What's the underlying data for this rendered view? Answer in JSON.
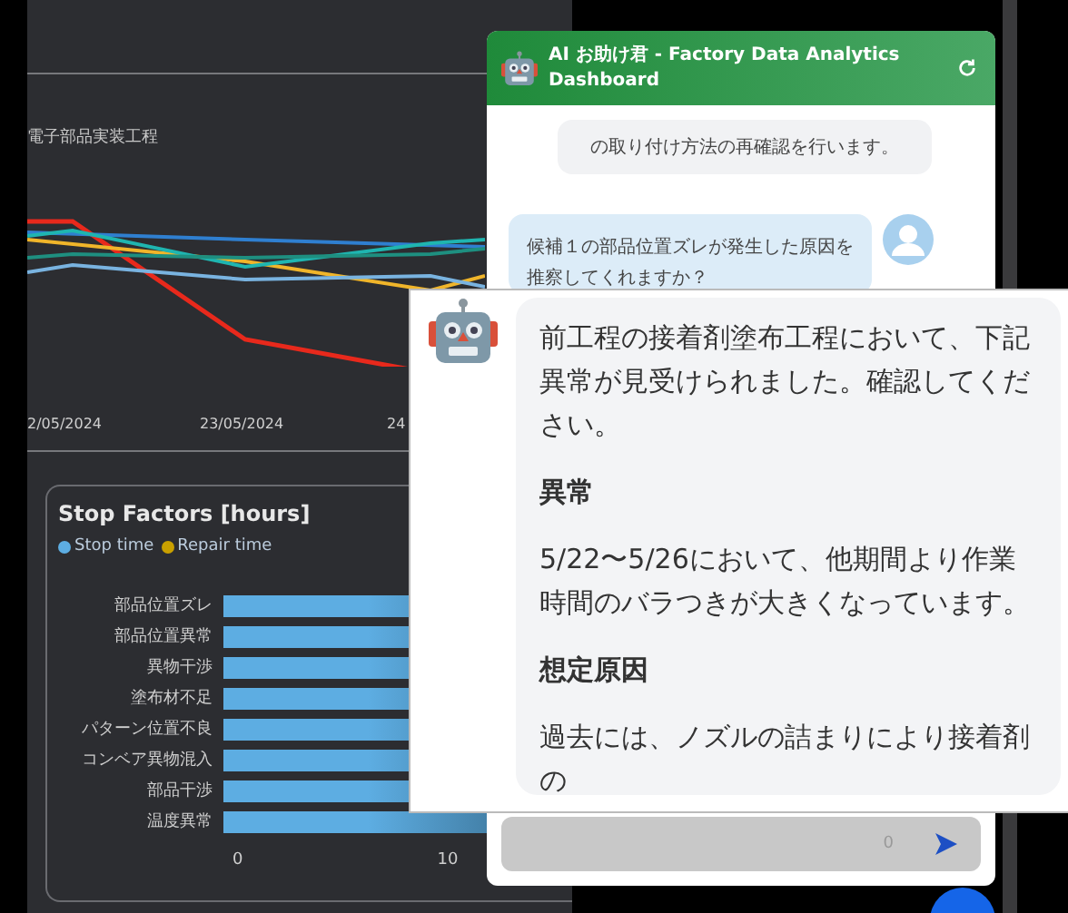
{
  "dashboard": {
    "line_chart": {
      "subtitle": "電子部品実装工程",
      "x_labels": [
        "2/05/2024",
        "23/05/2024",
        "24"
      ]
    },
    "stop_factors": {
      "title": "Stop Factors [hours]",
      "legend": [
        {
          "label": "Stop time",
          "color": "#5dade2"
        },
        {
          "label": "Repair time",
          "color": "#c9a000"
        }
      ],
      "categories": [
        "部品位置ズレ",
        "部品位置異常",
        "異物干渉",
        "塗布材不足",
        "パターン位置不良",
        "コンベア異物混入",
        "部品干渉",
        "温度異常"
      ],
      "x_ticks": [
        "0",
        "10"
      ]
    }
  },
  "chat": {
    "title": "AI お助け君 - Factory Data Analytics Dashboard",
    "messages": [
      {
        "kind": "bot",
        "lines": [
          "の取り付け方法の再確認を行います。"
        ]
      },
      {
        "kind": "user",
        "lines": [
          "候補１の部品位置ズレが発生した原因を",
          "推察してくれますか？"
        ]
      }
    ],
    "popup": [
      {
        "kind": "text",
        "text": "前工程の接着剤塗布工程において、下記異常が見受けられました。確認してください。"
      },
      {
        "kind": "heading",
        "text": "異常"
      },
      {
        "kind": "text",
        "text": "5/22〜5/26において、他期間より作業時間のバラつきが大きくなっています。"
      },
      {
        "kind": "heading",
        "text": "想定原因"
      },
      {
        "kind": "text",
        "text": "過去には、ノズルの詰まりにより接着剤の"
      }
    ],
    "input": {
      "counter": "0"
    }
  }
}
